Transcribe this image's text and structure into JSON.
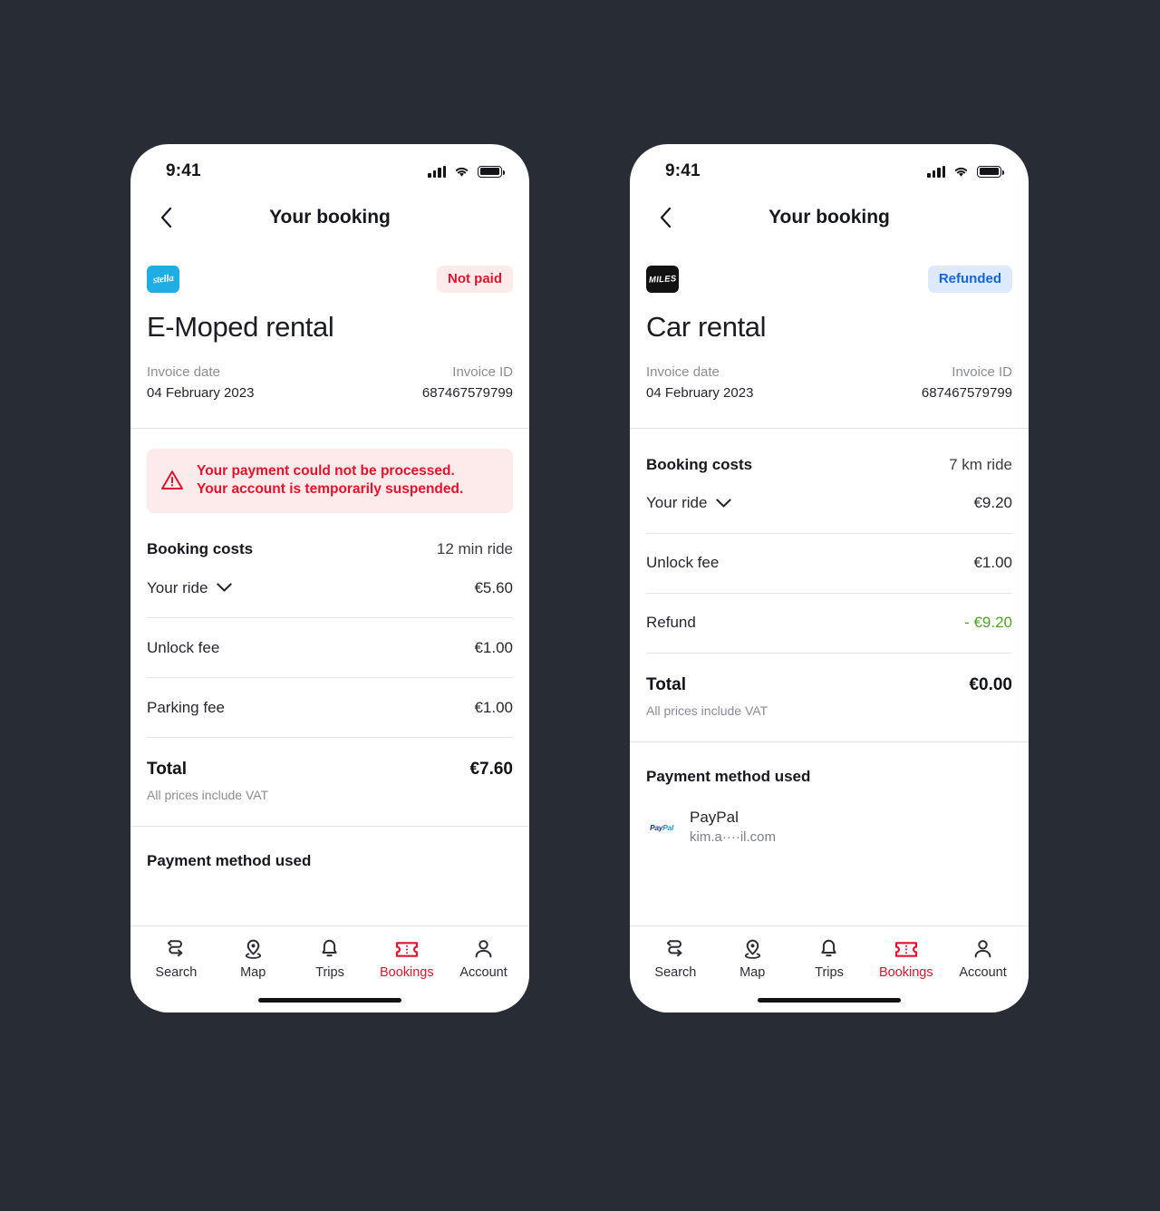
{
  "background_color": "#282c35",
  "accent_color": "#e2142d",
  "screens": [
    {
      "id": "e-moped",
      "statusbar": {
        "time": "9:41"
      },
      "header": {
        "title": "Your booking",
        "back_icon": "chevron-left-icon"
      },
      "brand": {
        "logo_text": "stella",
        "logo_color": "#1eaee3"
      },
      "status_badge": {
        "label": "Not paid",
        "bg": "#fdeaea",
        "fg": "#e2142d"
      },
      "booking_title": "E-Moped rental",
      "meta": {
        "invoice_date_label": "Invoice date",
        "invoice_date_value": "04 February 2023",
        "invoice_id_label": "Invoice ID",
        "invoice_id_value": "687467579799"
      },
      "alert": {
        "icon": "warning-triangle-icon",
        "line1": "Your payment could not be processed.",
        "line2": "Your account is temporarily suspended.",
        "bg": "#fdeaea",
        "fg": "#e2142d"
      },
      "costs": {
        "heading": "Booking costs",
        "summary": "12 min ride",
        "rows": [
          {
            "label": "Your ride",
            "amount": "€5.60",
            "expandable": true,
            "color": "#26282e"
          },
          {
            "label": "Unlock fee",
            "amount": "€1.00",
            "expandable": false,
            "color": "#26282e"
          },
          {
            "label": "Parking fee",
            "amount": "€1.00",
            "expandable": false,
            "color": "#26282e"
          }
        ],
        "total_label": "Total",
        "total_amount": "€7.60",
        "vat_note": "All prices include VAT"
      },
      "payment": {
        "title": "Payment method used",
        "method": null,
        "email": null
      },
      "tabs": [
        {
          "label": "Search",
          "icon": "route-icon",
          "active": false
        },
        {
          "label": "Map",
          "icon": "map-pin-icon",
          "active": false
        },
        {
          "label": "Trips",
          "icon": "bell-icon",
          "active": false
        },
        {
          "label": "Bookings",
          "icon": "ticket-icon",
          "active": true
        },
        {
          "label": "Account",
          "icon": "person-icon",
          "active": false
        }
      ]
    },
    {
      "id": "car",
      "statusbar": {
        "time": "9:41"
      },
      "header": {
        "title": "Your booking",
        "back_icon": "chevron-left-icon"
      },
      "brand": {
        "logo_text": "MILES",
        "logo_color": "#121212"
      },
      "status_badge": {
        "label": "Refunded",
        "bg": "#dceafb",
        "fg": "#1565d8"
      },
      "booking_title": "Car rental",
      "meta": {
        "invoice_date_label": "Invoice date",
        "invoice_date_value": "04 February 2023",
        "invoice_id_label": "Invoice ID",
        "invoice_id_value": "687467579799"
      },
      "alert": null,
      "costs": {
        "heading": "Booking costs",
        "summary": "7 km ride",
        "rows": [
          {
            "label": "Your ride",
            "amount": "€9.20",
            "expandable": true,
            "color": "#26282e"
          },
          {
            "label": "Unlock fee",
            "amount": "€1.00",
            "expandable": false,
            "color": "#26282e"
          },
          {
            "label": "Refund",
            "amount": "- €9.20",
            "expandable": false,
            "color": "#4fa32a"
          }
        ],
        "total_label": "Total",
        "total_amount": "€0.00",
        "vat_note": "All prices include VAT"
      },
      "payment": {
        "title": "Payment method used",
        "method": "PayPal",
        "email": "kim.a····il.com",
        "logo": "paypal-logo"
      },
      "tabs": [
        {
          "label": "Search",
          "icon": "route-icon",
          "active": false
        },
        {
          "label": "Map",
          "icon": "map-pin-icon",
          "active": false
        },
        {
          "label": "Trips",
          "icon": "bell-icon",
          "active": false
        },
        {
          "label": "Bookings",
          "icon": "ticket-icon",
          "active": true
        },
        {
          "label": "Account",
          "icon": "person-icon",
          "active": false
        }
      ]
    }
  ]
}
